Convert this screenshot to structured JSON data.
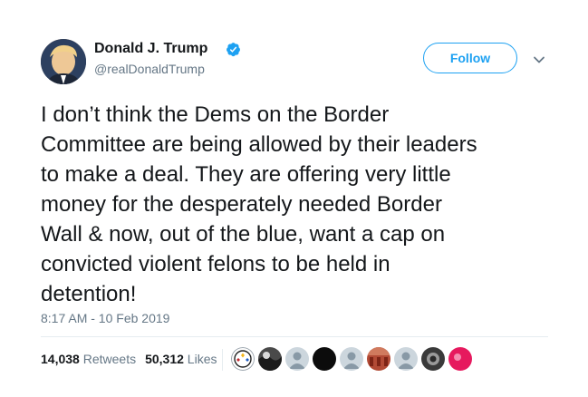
{
  "author": {
    "display_name": "Donald J. Trump",
    "handle": "@realDonaldTrump",
    "verified": true,
    "avatar_icon": "profile-photo"
  },
  "follow_button": {
    "label": "Follow",
    "color": "#1da1f2"
  },
  "more_menu_icon": "chevron-down-icon",
  "tweet": {
    "text": "I don’t think the Dems on the Border\nCommittee are being allowed by their leaders\nto make a deal. They are offering very little\nmoney for the desperately needed Border\nWall & now, out of the blue, want a cap on\nconvicted violent felons to be held in\ndetention!",
    "timestamp": "8:17 AM - 10 Feb 2019"
  },
  "stats": {
    "retweets_count": "14,038",
    "retweets_label": "Retweets",
    "likes_count": "50,312",
    "likes_label": "Likes"
  },
  "likers": [
    "steelers-logo",
    "dark-photo",
    "default-avatar",
    "black-avatar",
    "default-avatar",
    "red-photo",
    "default-avatar",
    "dark-photo",
    "pink-avatar"
  ]
}
